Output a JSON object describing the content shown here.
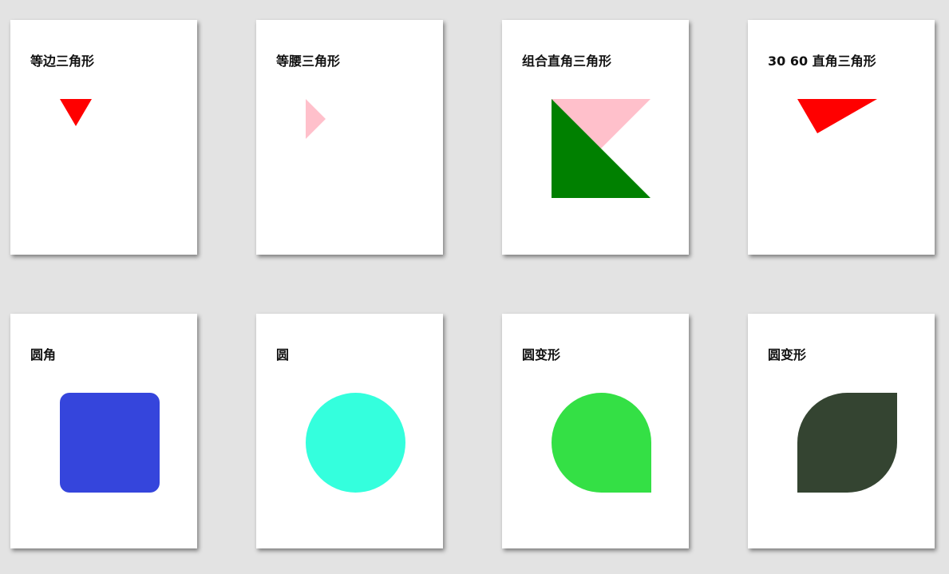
{
  "cards": [
    {
      "title": "等边三角形",
      "shape": "equilateral-triangle",
      "color": "#ff0000"
    },
    {
      "title": "等腰三角形",
      "shape": "isosceles-triangle",
      "color": "#ffc0cb"
    },
    {
      "title": "组合直角三角形",
      "shape": "combined-right-triangle",
      "colors": [
        "#ffc0cb",
        "#008000"
      ]
    },
    {
      "title": "30 60 直角三角形",
      "shape": "30-60-right-triangle",
      "color": "#ff0000"
    },
    {
      "title": "圆角",
      "shape": "rounded-square",
      "color": "#3545dc"
    },
    {
      "title": "圆",
      "shape": "circle",
      "color": "#34ffdd"
    },
    {
      "title": "圆变形",
      "shape": "teardrop",
      "color": "#34e045"
    },
    {
      "title": "圆变形",
      "shape": "leaf",
      "color": "#344431"
    }
  ]
}
